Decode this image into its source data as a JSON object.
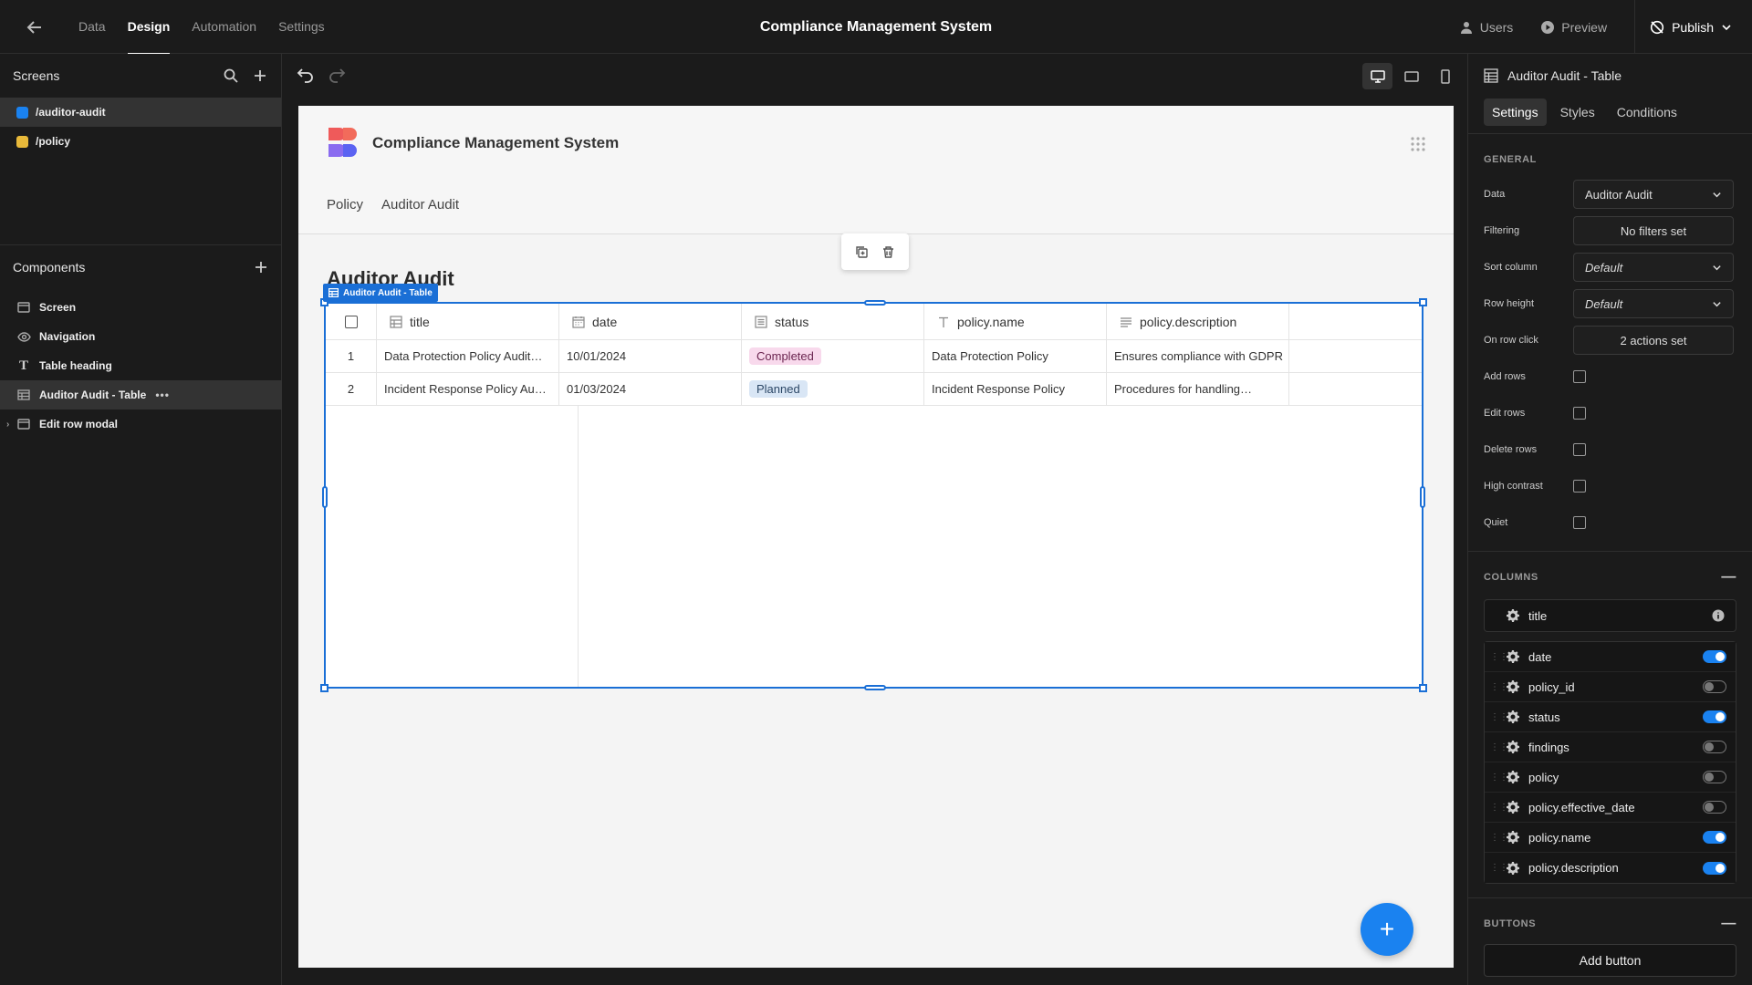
{
  "topbar": {
    "tabs": [
      {
        "label": "Data",
        "active": false
      },
      {
        "label": "Design",
        "active": true
      },
      {
        "label": "Automation",
        "active": false
      },
      {
        "label": "Settings",
        "active": false
      }
    ],
    "app_title": "Compliance Management System",
    "users_label": "Users",
    "preview_label": "Preview",
    "publish_label": "Publish"
  },
  "screens": {
    "title": "Screens",
    "items": [
      {
        "label": "/auditor-audit",
        "color": "#1a82f0"
      },
      {
        "label": "/policy",
        "color": "#e8b93a"
      }
    ]
  },
  "components": {
    "title": "Components",
    "items": [
      {
        "label": "Screen",
        "icon": "screen-icon"
      },
      {
        "label": "Navigation",
        "icon": "eye-icon"
      },
      {
        "label": "Table heading",
        "icon": "text-icon"
      },
      {
        "label": "Auditor Audit - Table",
        "icon": "table-icon"
      },
      {
        "label": "Edit row modal",
        "icon": "modal-icon"
      }
    ]
  },
  "page": {
    "title": "Compliance Management System",
    "nav": [
      "Policy",
      "Auditor Audit"
    ],
    "heading": "Auditor Audit",
    "component_tag": "Auditor Audit - Table",
    "table": {
      "columns": [
        "title",
        "date",
        "status",
        "policy.name",
        "policy.description"
      ],
      "rows": [
        {
          "num": "1",
          "title": "Data Protection Policy Audit…",
          "date": "10/01/2024",
          "status": "Completed",
          "policy_name": "Data Protection Policy",
          "policy_description": "Ensures compliance with GDPR"
        },
        {
          "num": "2",
          "title": "Incident Response Policy Au…",
          "date": "01/03/2024",
          "status": "Planned",
          "policy_name": "Incident Response Policy",
          "policy_description": "Procedures for handling…"
        }
      ]
    },
    "fab_label": "+"
  },
  "settings_panel": {
    "title": "Auditor Audit - Table",
    "tabs": [
      "Settings",
      "Styles",
      "Conditions"
    ],
    "general_title": "GENERAL",
    "data_label": "Data",
    "data_value": "Auditor Audit",
    "filtering_label": "Filtering",
    "filtering_value": "No filters set",
    "sort_label": "Sort column",
    "sort_value": "Default",
    "row_height_label": "Row height",
    "row_height_value": "Default",
    "on_row_click_label": "On row click",
    "on_row_click_value": "2 actions set",
    "add_rows_label": "Add rows",
    "edit_rows_label": "Edit rows",
    "delete_rows_label": "Delete rows",
    "high_contrast_label": "High contrast",
    "quiet_label": "Quiet",
    "columns_title": "COLUMNS",
    "title_column": "title",
    "columns": [
      {
        "name": "date",
        "enabled": true
      },
      {
        "name": "policy_id",
        "enabled": false
      },
      {
        "name": "status",
        "enabled": true
      },
      {
        "name": "findings",
        "enabled": false
      },
      {
        "name": "policy",
        "enabled": false
      },
      {
        "name": "policy.effective_date",
        "enabled": false
      },
      {
        "name": "policy.name",
        "enabled": true
      },
      {
        "name": "policy.description",
        "enabled": true
      }
    ],
    "buttons_title": "BUTTONS",
    "add_button_label": "Add button"
  }
}
